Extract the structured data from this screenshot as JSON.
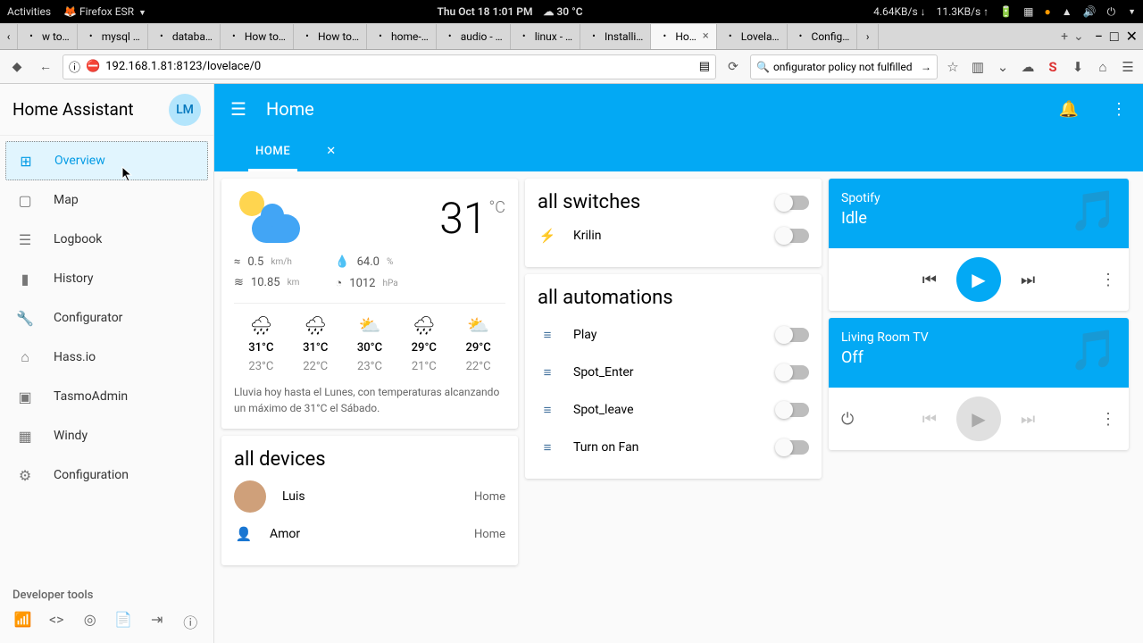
{
  "topbar": {
    "activities": "Activities",
    "app": "Firefox ESR",
    "datetime": "Thu Oct 18  1:01 PM",
    "temp": "30 °C",
    "net_down": "4.64KB/s",
    "net_up": "11.3KB/s"
  },
  "tabs": [
    {
      "label": "w to…"
    },
    {
      "label": "mysql …"
    },
    {
      "label": "databa…"
    },
    {
      "label": "How to…"
    },
    {
      "label": "How to…"
    },
    {
      "label": "home-…"
    },
    {
      "label": "audio - …"
    },
    {
      "label": "linux - …"
    },
    {
      "label": "Installi…"
    },
    {
      "label": "Ho…",
      "active": true
    },
    {
      "label": "Lovela…"
    },
    {
      "label": "Config…"
    }
  ],
  "url": {
    "address": "192.168.1.81:8123/lovelace/0",
    "search": "onfigurator policy not fulfilled"
  },
  "sidebar": {
    "title": "Home Assistant",
    "avatar": "LM",
    "dev_title": "Developer tools",
    "items": [
      {
        "label": "Overview",
        "icon": "⊞",
        "active": true
      },
      {
        "label": "Map",
        "icon": "▢"
      },
      {
        "label": "Logbook",
        "icon": "☰"
      },
      {
        "label": "History",
        "icon": "▮"
      },
      {
        "label": "Configurator",
        "icon": "🔧"
      },
      {
        "label": "Hass.io",
        "icon": "⌂"
      },
      {
        "label": "TasmoAdmin",
        "icon": "▣"
      },
      {
        "label": "Windy",
        "icon": "▦"
      },
      {
        "label": "Configuration",
        "icon": "⚙"
      }
    ]
  },
  "header": {
    "title": "Home",
    "tab": "HOME"
  },
  "weather": {
    "temp": "31",
    "unit": "°C",
    "wind": "0.5",
    "wind_u": "km/h",
    "vis": "10.85",
    "vis_u": "km",
    "humidity": "64.0",
    "humidity_u": "%",
    "pressure": "1012",
    "pressure_u": "hPa",
    "forecast": [
      {
        "hi": "31°C",
        "lo": "23°C",
        "i": "🌧"
      },
      {
        "hi": "31°C",
        "lo": "22°C",
        "i": "🌧"
      },
      {
        "hi": "30°C",
        "lo": "23°C",
        "i": "⛅"
      },
      {
        "hi": "29°C",
        "lo": "21°C",
        "i": "🌧"
      },
      {
        "hi": "29°C",
        "lo": "22°C",
        "i": "⛅"
      }
    ],
    "desc": "Lluvia hoy hasta el Lunes, con temperaturas alcanzando un máximo de 31°C el Sábado."
  },
  "devices": {
    "title": "all devices",
    "rows": [
      {
        "name": "Luis",
        "state": "Home"
      },
      {
        "name": "Amor",
        "state": "Home"
      }
    ]
  },
  "switches": {
    "title": "all switches",
    "rows": [
      {
        "name": "Krilin"
      }
    ]
  },
  "automations": {
    "title": "all automations",
    "rows": [
      {
        "name": "Play"
      },
      {
        "name": "Spot_Enter"
      },
      {
        "name": "Spot_leave"
      },
      {
        "name": "Turn on Fan"
      }
    ]
  },
  "media": [
    {
      "name": "Spotify",
      "state": "Idle",
      "playable": true
    },
    {
      "name": "Living Room TV",
      "state": "Off",
      "playable": false
    }
  ]
}
